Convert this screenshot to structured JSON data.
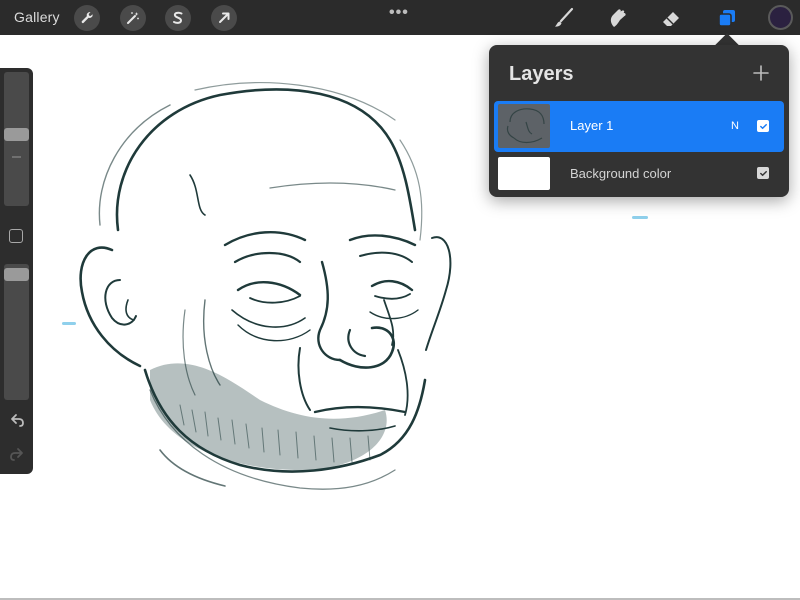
{
  "topbar": {
    "gallery_label": "Gallery",
    "tools_left": [
      {
        "name": "actions",
        "icon": "wrench-icon"
      },
      {
        "name": "adjustments",
        "icon": "magic-wand-icon"
      },
      {
        "name": "selection",
        "icon": "selection-s-icon"
      },
      {
        "name": "transform",
        "icon": "transform-arrow-icon"
      }
    ],
    "more_label": "•••",
    "tools_right": [
      {
        "name": "brush",
        "icon": "brush-icon",
        "active": false
      },
      {
        "name": "smudge",
        "icon": "smudge-icon",
        "active": false
      },
      {
        "name": "eraser",
        "icon": "eraser-icon",
        "active": false
      },
      {
        "name": "layers",
        "icon": "layers-icon",
        "active": true
      }
    ],
    "current_color": "#2b2140"
  },
  "layers_panel": {
    "title": "Layers",
    "add_label": "+",
    "layers": [
      {
        "name": "Layer 1",
        "blend_mode": "N",
        "visible": true,
        "selected": true
      },
      {
        "name": "Background color",
        "blend_mode": "",
        "visible": true,
        "selected": false
      }
    ]
  },
  "colors": {
    "toolbar_bg": "#2b2b2b",
    "panel_bg": "#333333",
    "accent_blue": "#1a7cf5",
    "sketch_ink": "#1f3a3a"
  }
}
